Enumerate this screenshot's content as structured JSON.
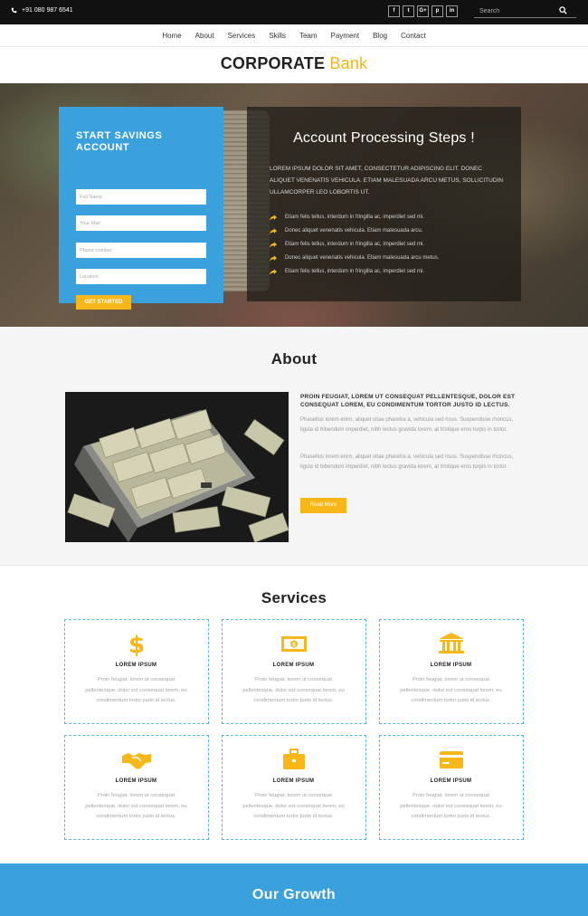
{
  "topbar": {
    "phone": "+91 080 987 6541",
    "socials": [
      "f",
      "t",
      "G+",
      "p",
      "in"
    ],
    "search_placeholder": "Search"
  },
  "nav": [
    "Home",
    "About",
    "Services",
    "Skills",
    "Team",
    "Payment",
    "Blog",
    "Contact"
  ],
  "logo": {
    "main": "CORPORATE",
    "accent": "Bank"
  },
  "savings": {
    "title": "START SAVINGS ACCOUNT",
    "placeholders": [
      "Full Name",
      "Your Mail",
      "Phone number",
      "Location"
    ],
    "button": "GET STARTED"
  },
  "steps": {
    "title": "Account Processing Steps !",
    "description": "LOREM IPSUM DOLOR SIT AMET, CONSECTETUR ADIPISCING ELIT. DONEC ALIQUET VENENATIS VEHICULA. ETIAM MALESUADA ARCU METUS, SOLLICITUDIN ULLAMCORPER LEO LOBORTIS UT.",
    "items": [
      "Etiam felis tellus, interdum in fringilla ac, imperdiet sed mi.",
      "Donec aliquet venenatis vehicula. Etiam malesuada arcu.",
      "Etiam felis tellus, interdum in fringilla ac, imperdiet sed mi.",
      "Donec aliquet venenatis vehicula. Etiam malesuada arcu metus.",
      "Etiam felis tellus, interdum in fringilla ac, imperdiet sed mi."
    ]
  },
  "about": {
    "title": "About",
    "heading": "PROIN FEUGIAT, LOREM UT CONSEQUAT PELLENTESQUE, DOLOR EST CONSEQUAT LOREM, EU CONDIMENTUM TORTOR JUSTO ID LECTUS.",
    "para1": "Phasellus lorem enim, aliquet vitae pharetra a, vehicula sed risus. Suspendisse rhoncus, ligula id bibendum imperdiet, nibh lectus gravida lorem, at tristique eros turpis in tortor.",
    "para2": "Phasellus lorem enim, aliquet vitae pharetra a, vehicula sed risus. Suspendisse rhoncus, ligula id bibendum imperdiet, nibh lectus gravida lorem, at tristique eros turpis in tortor.",
    "button": "Read More"
  },
  "services": {
    "title": "Services",
    "cards": [
      {
        "icon": "dollar-icon",
        "title": "LOREM IPSUM",
        "desc": "Proin feugiat, lorem ut consequat pellentesque, dolor est consequat lorem, eu condimentum tortor justo id lectus."
      },
      {
        "icon": "banknote-icon",
        "title": "LOREM IPSUM",
        "desc": "Proin feugiat, lorem ut consequat pellentesque, dolor est consequat lorem, eu condimentum tortor justo id lectus."
      },
      {
        "icon": "bank-icon",
        "title": "LOREM IPSUM",
        "desc": "Proin feugiat, lorem ut consequat pellentesque, dolor est consequat lorem, eu condimentum tortor justo id lectus."
      },
      {
        "icon": "handshake-icon",
        "title": "LOREM IPSUM",
        "desc": "Proin feugiat, lorem ut consequat pellentesque, dolor est consequat lorem, eu condimentum tortor justo id lectus."
      },
      {
        "icon": "briefcase-icon",
        "title": "LOREM IPSUM",
        "desc": "Proin feugiat, lorem ut consequat pellentesque, dolor est consequat lorem, eu condimentum tortor justo id lectus."
      },
      {
        "icon": "credit-card-icon",
        "title": "LOREM IPSUM",
        "desc": "Proin feugiat, lorem ut consequat pellentesque, dolor est consequat lorem, eu condimentum tortor justo id lectus."
      }
    ]
  },
  "growth": {
    "title": "Our Growth"
  },
  "colors": {
    "accent": "#f7b718",
    "blue": "#3aa1dd",
    "dark": "#111111",
    "card_border": "#5bb3e0"
  }
}
